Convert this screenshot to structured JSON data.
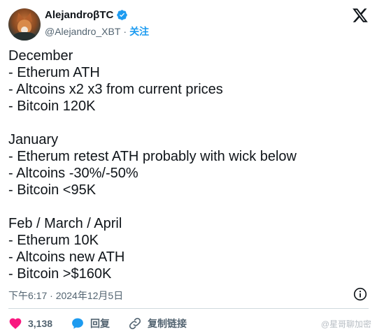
{
  "author": {
    "display_name": "AlejandroβTC",
    "handle": "@Alejandro_XBT",
    "separator": "·",
    "follow_label": "关注"
  },
  "tweet": {
    "lines": [
      "December",
      "- Etherum ATH",
      "- Altcoins x2 x3 from current prices",
      "- Bitcoin 120K",
      "",
      "January",
      "- Etherum retest ATH probably with wick below",
      "- Altcoins -30%/-50%",
      "- Bitcoin <95K",
      "",
      "Feb / March / April",
      "- Etherum 10K",
      "- Altcoins new ATH",
      "- Bitcoin >$160K"
    ],
    "timestamp": "下午6:17 · 2024年12月5日"
  },
  "actions": {
    "like_count": "3,138",
    "reply_label": "回复",
    "copy_link_label": "复制链接"
  },
  "watermark": "@星哥聊加密",
  "colors": {
    "like": "#f91880",
    "accent": "#1d9bf0",
    "muted": "#536471"
  },
  "icons": [
    "verified-badge-icon",
    "x-logo-icon",
    "info-icon",
    "heart-icon",
    "reply-icon",
    "link-icon"
  ]
}
